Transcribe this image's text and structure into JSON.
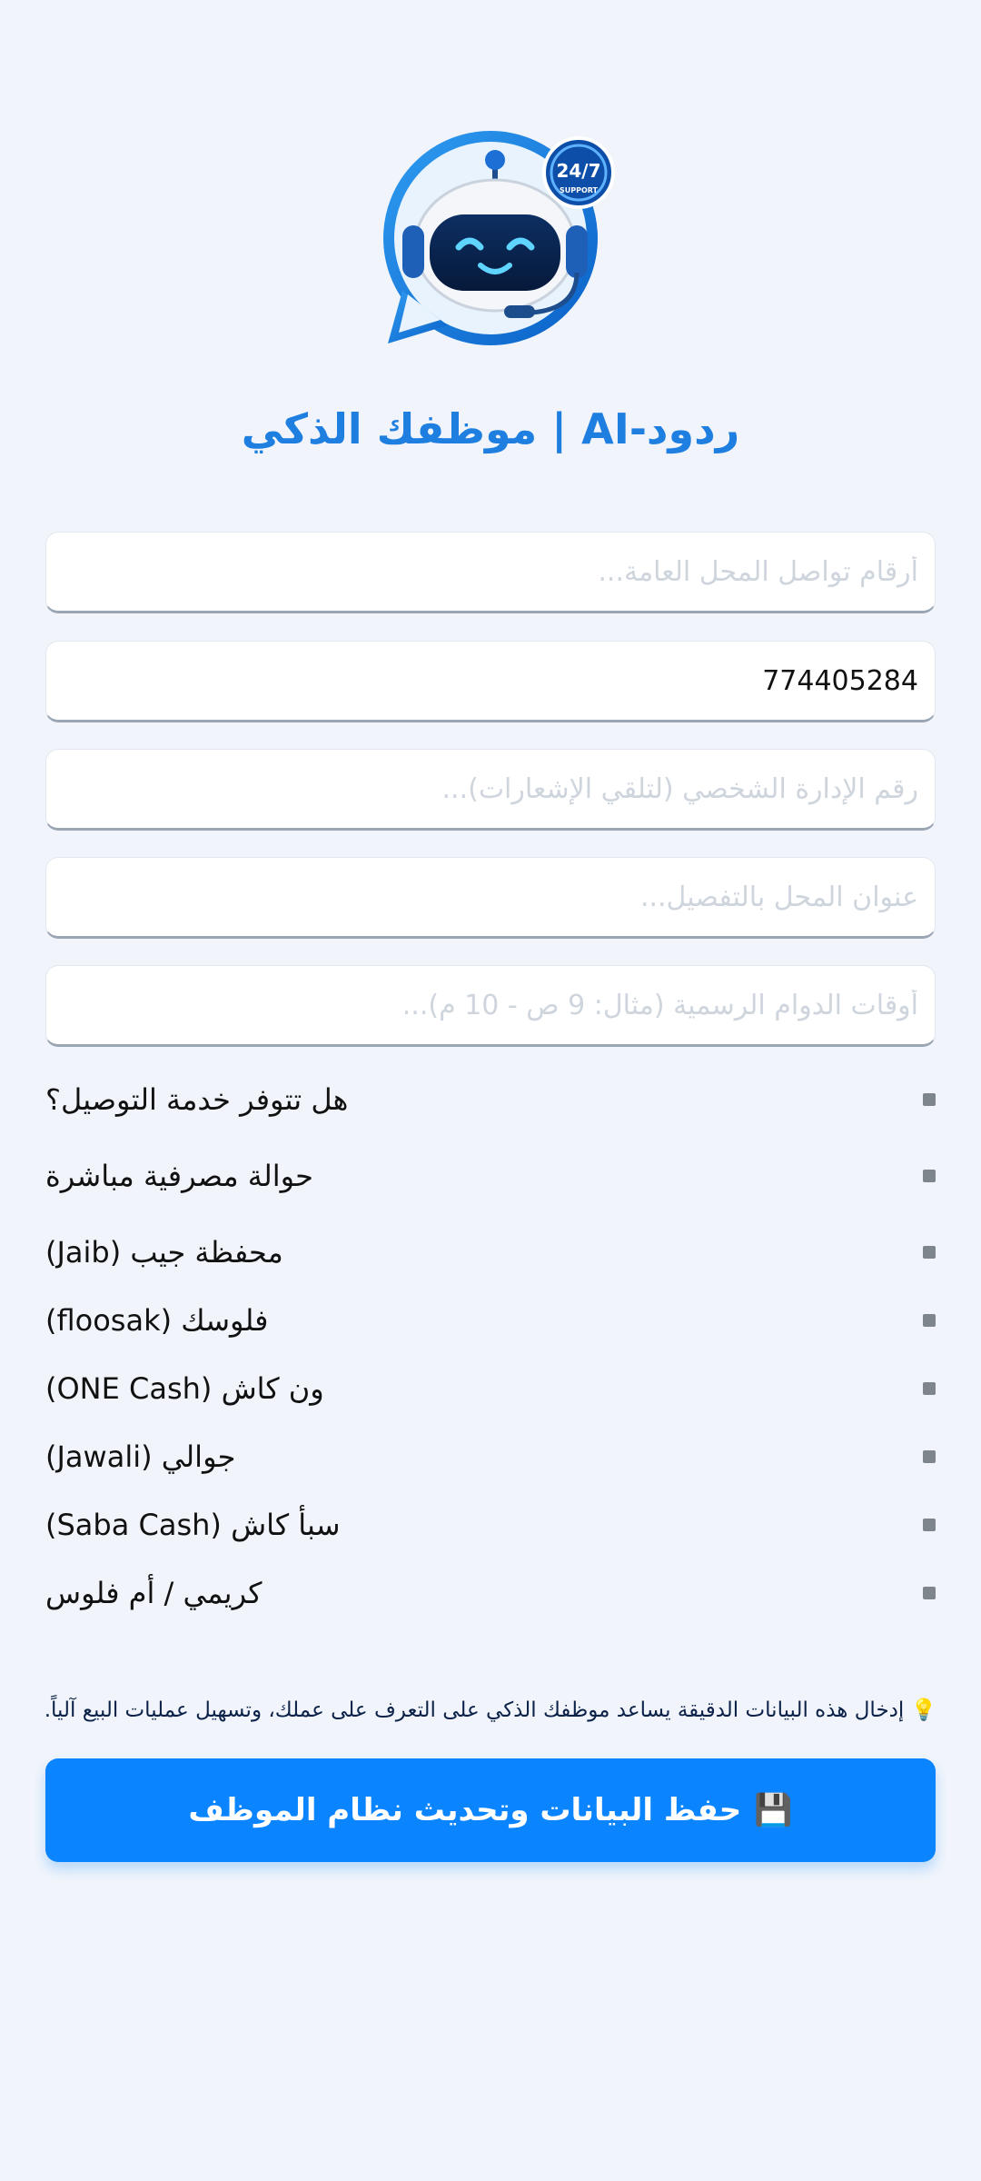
{
  "logo": {
    "icon": "support-robot-icon",
    "badge_text": "24/7",
    "badge_subtext": "SUPPORT"
  },
  "title": "ردود-AI | موظفك الذكي",
  "fields": [
    {
      "placeholder": "أرقام تواصل المحل العامة...",
      "value": ""
    },
    {
      "placeholder": "",
      "value": "774405284"
    },
    {
      "placeholder": "رقم الإدارة الشخصي (لتلقي الإشعارات)...",
      "value": ""
    },
    {
      "placeholder": "عنوان المحل بالتفصيل...",
      "value": ""
    },
    {
      "placeholder": "أوقات الدوام الرسمية (مثال: 9 ص - 10 م)...",
      "value": ""
    }
  ],
  "options": [
    {
      "label": "هل تتوفر خدمة التوصيل؟"
    },
    {
      "label": "حوالة مصرفية مباشرة"
    },
    {
      "label": "محفظة جيب (Jaib)"
    },
    {
      "label": "فلوسك (floosak)"
    },
    {
      "label": "ون كاش (ONE Cash)"
    },
    {
      "label": "جوالي (Jawali)"
    },
    {
      "label": "سبأ كاش (Saba Cash)"
    },
    {
      "label": "كريمي / أم فلوس"
    }
  ],
  "note": {
    "icon": "💡",
    "text": "إدخال هذه البيانات الدقيقة يساعد موظفك الذكي على التعرف على عملك، وتسهيل عمليات البيع آلياً."
  },
  "save_button": {
    "icon": "💾",
    "label": "حفظ البيانات وتحديث نظام الموظف"
  },
  "colors": {
    "accent": "#0a84ff",
    "title": "#1f7fe0",
    "background": "#f1f5fb"
  }
}
